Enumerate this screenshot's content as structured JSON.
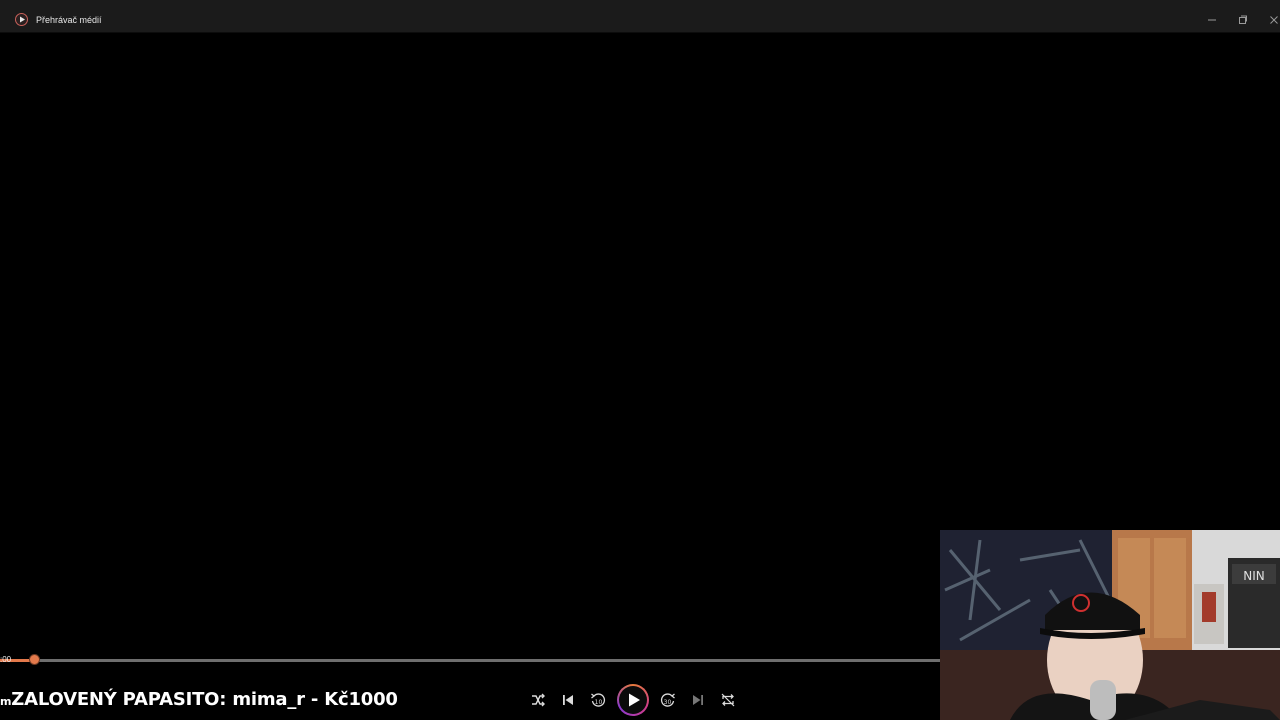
{
  "window": {
    "title": "Přehrávač médií",
    "icons": {
      "app": "play-circle-icon",
      "minimize": "minimize-icon",
      "maximize": "restore-icon",
      "close": "close-icon"
    }
  },
  "player": {
    "current_time": ":00",
    "progress_fraction": 0.036,
    "controls": [
      "shuffle-icon",
      "previous-icon",
      "rewind-10-icon",
      "play-icon",
      "forward-30-icon",
      "next-icon",
      "repeat-icon"
    ],
    "accent": "#e3794b"
  },
  "overlay": {
    "donation_prefix": "m",
    "donation_text": "ZALOVENÝ PAPASITO: mima_r - Kč1000"
  }
}
